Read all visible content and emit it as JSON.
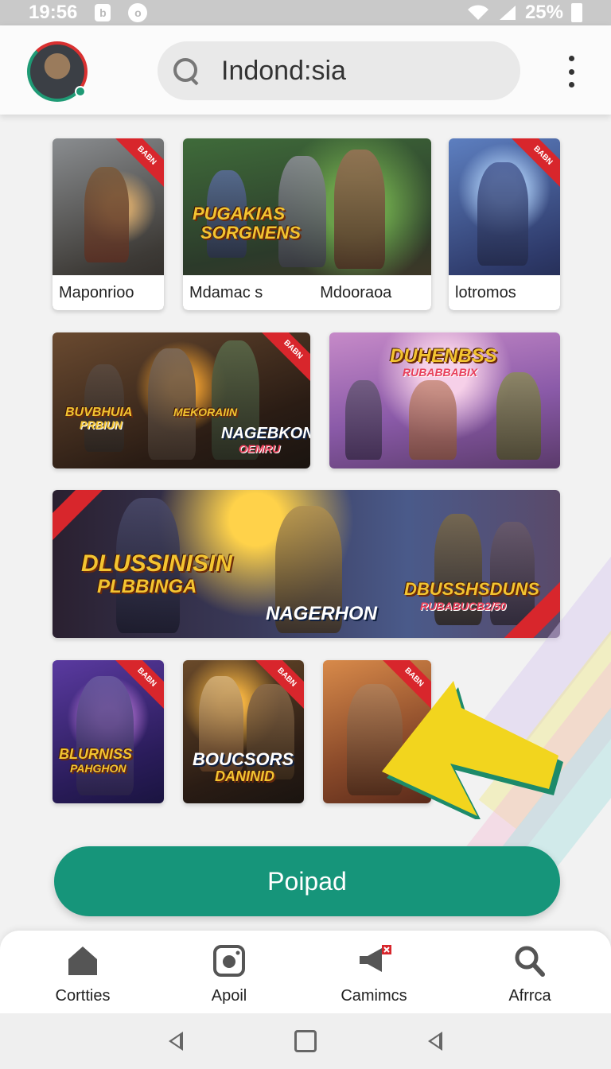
{
  "status_bar": {
    "time": "19:56",
    "battery": "25%"
  },
  "header": {
    "search_text": "Indond:sia"
  },
  "cards": {
    "c1": {
      "caption": "Maponrioo"
    },
    "c2": {
      "caption_left": "Mdamac s",
      "caption_right": "Mdooraoa",
      "title_line1": "PUGAKIAS",
      "title_line2": "SORGNENS"
    },
    "c3": {
      "caption": "lotromos"
    },
    "c4": {
      "title_left_1": "BUVBHUIA",
      "title_left_2": "PRBIUN",
      "title_mid": "MEKORAIIN",
      "title_right_1": "NAGEBKON",
      "title_right_2": "OEMRU"
    },
    "c5": {
      "title_1": "DUHENBSS",
      "title_2": "RUBABBABIX"
    },
    "c6": {
      "title_left_1": "DLUSSINISIN",
      "title_left_2": "PLBBINGA",
      "title_mid": "NAGERHON",
      "title_right_1": "DBUSSHSDUNS",
      "title_right_2": "RUBABUCB2/50"
    },
    "c7": {
      "title_1": "BLURNISS",
      "title_2": "PAHGHON"
    },
    "c8": {
      "title_1": "BOUCSORS",
      "title_2": "DANINID"
    }
  },
  "cta": {
    "label": "Poipad"
  },
  "bottom_nav": [
    {
      "label": "Cortties",
      "icon": "home-icon"
    },
    {
      "label": "Apoil",
      "icon": "camera-icon"
    },
    {
      "label": "Camimcs",
      "icon": "megaphone-icon"
    },
    {
      "label": "Afrrca",
      "icon": "search-icon"
    }
  ],
  "colors": {
    "accent": "#16957a",
    "ribbon": "#d8262c",
    "arrow": "#f2d51e",
    "arrow_edge": "#1d8a6a"
  }
}
